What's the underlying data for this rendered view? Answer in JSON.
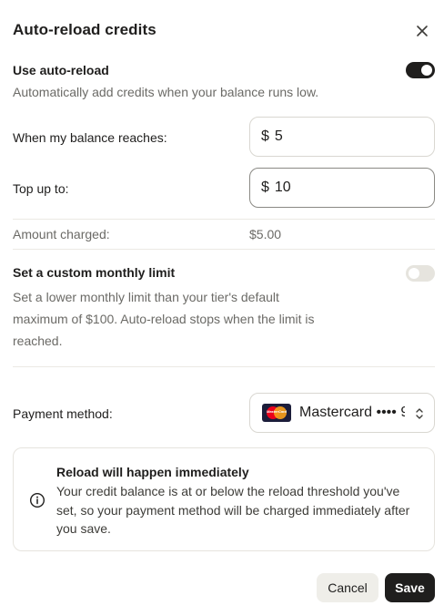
{
  "dialog": {
    "title": "Auto-reload credits"
  },
  "auto_reload": {
    "label": "Use auto-reload",
    "description": "Automatically add credits when your balance runs low.",
    "enabled": true
  },
  "threshold": {
    "label": "When my balance reaches:",
    "currency": "$",
    "value": "5"
  },
  "top_up": {
    "label": "Top up to:",
    "currency": "$",
    "value": "10"
  },
  "amount_charged": {
    "label": "Amount charged:",
    "value": "$5.00"
  },
  "monthly_limit": {
    "label": "Set a custom monthly limit",
    "description_line1": "Set a lower monthly limit than your tier's default",
    "description_line2": "maximum of $100. Auto-reload stops when the limit is",
    "description_line3": "reached.",
    "enabled": false
  },
  "payment": {
    "label": "Payment method:",
    "card_logo_text": "MasterCard",
    "selected": "Mastercard •••• 9"
  },
  "notice": {
    "title": "Reload will happen immediately",
    "body": "Your credit balance is at or below the reload threshold you've set, so your payment method will be charged immediately after you save."
  },
  "actions": {
    "cancel_label": "Cancel",
    "save_label": "Save"
  },
  "colors": {
    "primary": "#1f1e1d",
    "muted_text": "#6b6a66",
    "border": "#d9d7d1"
  }
}
